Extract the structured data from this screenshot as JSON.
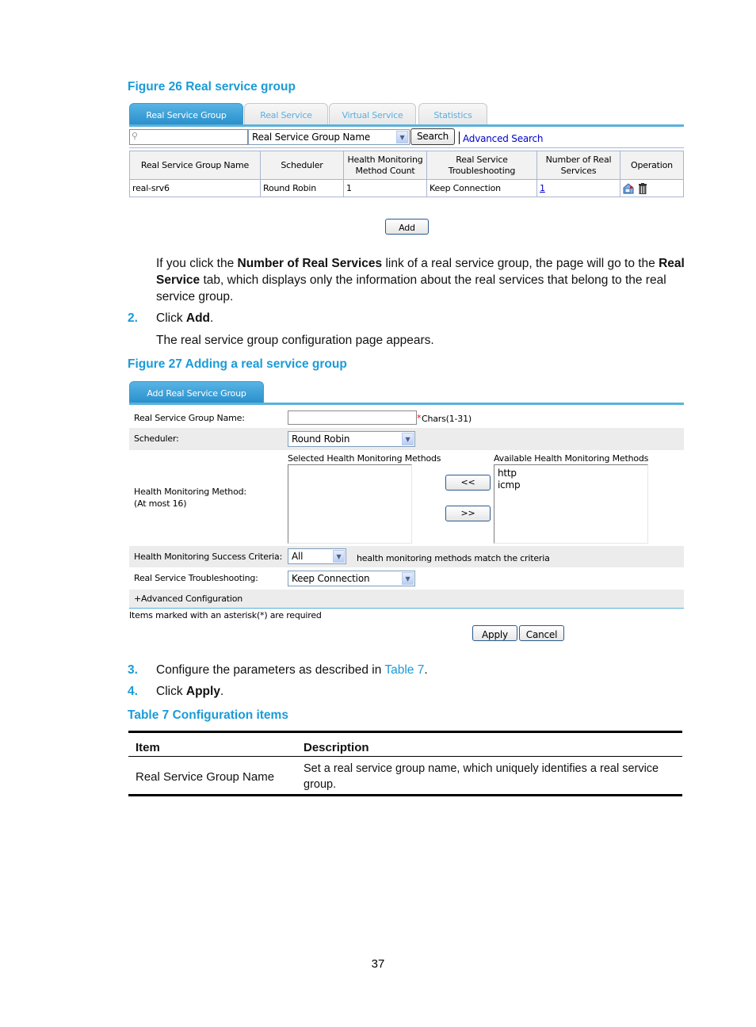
{
  "figure26": {
    "caption": "Figure 26 Real service group",
    "tabs": [
      {
        "label": "Real Service Group",
        "active": true
      },
      {
        "label": "Real Service",
        "active": false
      },
      {
        "label": "Virtual Service",
        "active": false
      },
      {
        "label": "Statistics",
        "active": false
      }
    ],
    "search": {
      "input_value": "",
      "field_select": "Real Service Group Name",
      "search_button": "Search",
      "advanced_link": "Advanced Search"
    },
    "table": {
      "headers": [
        [
          "Real Service Group Name"
        ],
        [
          "Scheduler"
        ],
        [
          "Health Monitoring",
          "Method Count"
        ],
        [
          "Real Service",
          "Troubleshooting"
        ],
        [
          "Number of Real",
          "Services"
        ],
        [
          "Operation"
        ]
      ],
      "rows": [
        {
          "name": "real-srv6",
          "scheduler": "Round Robin",
          "hm_count": "1",
          "troubleshooting": "Keep Connection",
          "num_real": "1",
          "operations": [
            "edit-icon",
            "delete-icon"
          ]
        }
      ]
    },
    "add_button": "Add"
  },
  "text": {
    "para1_pre": "If you click the ",
    "para1_bold1": "Number of Real Services",
    "para1_mid": " link of a real service group, the page will go to the ",
    "para1_bold2a": "Real",
    "para1_bold2b": "Service",
    "para1_post": " tab, which displays only the information about the real services that belong to the real",
    "para1_end": "service group.",
    "step2_num": "2.",
    "step2_pre": "Click ",
    "step2_bold": "Add",
    "step2_post": ".",
    "step2_result": "The real service group configuration page appears.",
    "step3_num": "3.",
    "step3_pre": "Configure the parameters as described in ",
    "step3_link": "Table 7",
    "step3_post": ".",
    "step4_num": "4.",
    "step4_pre": "Click ",
    "step4_bold": "Apply",
    "step4_post": "."
  },
  "figure27": {
    "caption": "Figure 27 Adding a real service group",
    "tab": "Add Real Service Group",
    "fields": {
      "name_label": "Real Service Group Name:",
      "name_value": "",
      "name_required": "*",
      "name_hint": "Chars(1-31)",
      "scheduler_label": "Scheduler:",
      "scheduler_value": "Round Robin",
      "hm_label": "Health Monitoring Method:",
      "hm_sublabel": "(At most 16)",
      "selected_title": "Selected Health Monitoring Methods",
      "selected_items": [],
      "available_title": "Available Health Monitoring Methods",
      "available_items": [
        "http",
        "icmp"
      ],
      "move_left": "<<",
      "move_right": ">>",
      "criteria_label": "Health Monitoring Success Criteria:",
      "criteria_value": "All",
      "criteria_suffix": "health monitoring methods match the criteria",
      "troubleshooting_label": "Real Service Troubleshooting:",
      "troubleshooting_value": "Keep Connection",
      "advanced": "+Advanced Configuration"
    },
    "required_note": "Items marked with an asterisk(*) are required",
    "apply_button": "Apply",
    "cancel_button": "Cancel"
  },
  "table7": {
    "caption": "Table 7 Configuration items",
    "headers": [
      "Item",
      "Description"
    ],
    "rows": [
      {
        "item": "Real Service Group Name",
        "desc_line1": "Set a real service group name, which uniquely identifies a real service",
        "desc_line2": "group."
      }
    ]
  },
  "page_number": "37",
  "colors": {
    "accent": "#1a9bd7",
    "tab_active": "#2a90cc",
    "link": "#0000cc",
    "required": "#ff0000"
  }
}
